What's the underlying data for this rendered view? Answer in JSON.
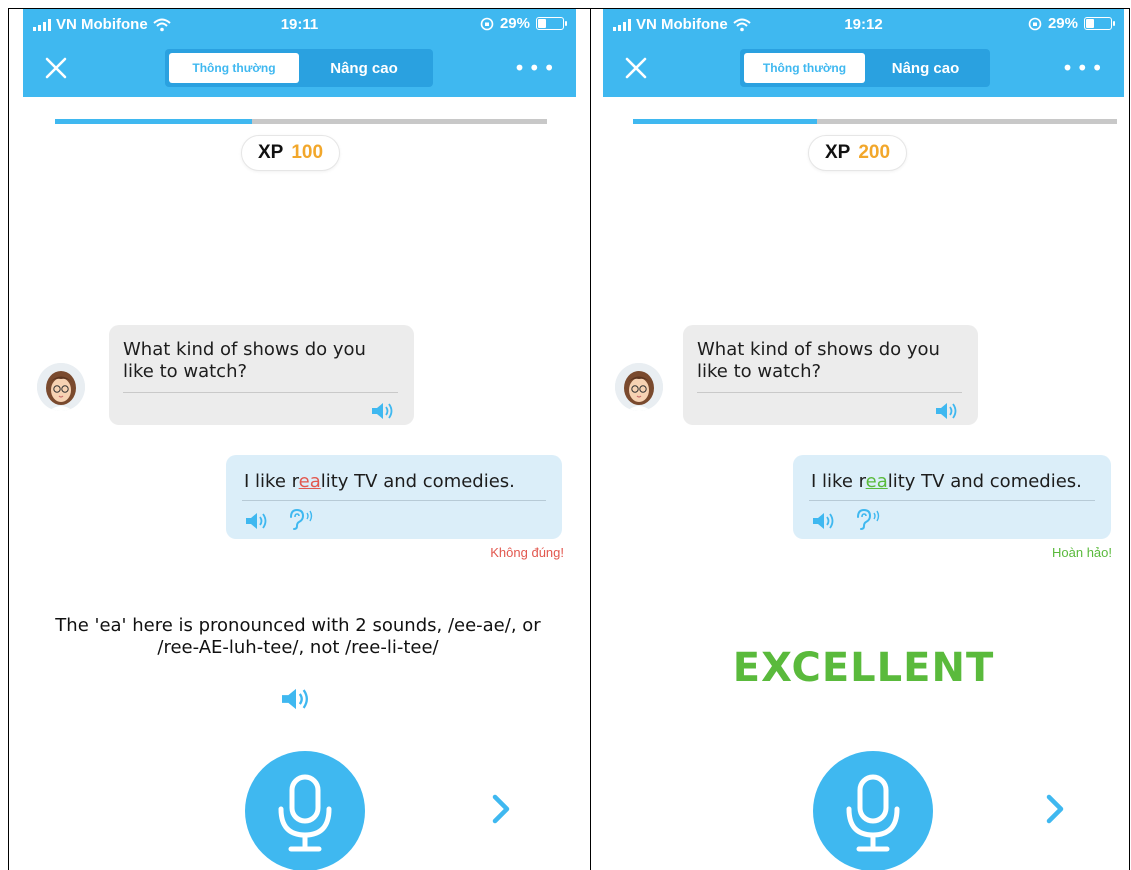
{
  "colors": {
    "brand": "#3fb8f0",
    "xp_value": "#f2a72b",
    "incorrect": "#e2584f",
    "correct": "#5aba3c"
  },
  "screens": [
    {
      "status": {
        "carrier": "VN Mobifone",
        "time": "19:11",
        "battery": "29%"
      },
      "tabs": {
        "normal": "Thông thường",
        "advanced": "Nâng cao",
        "active": "normal"
      },
      "progress": 0.4,
      "xp": {
        "label": "XP",
        "value": "100"
      },
      "question": {
        "text": "What kind of shows do you like to watch?"
      },
      "answer": {
        "before": "I like r",
        "highlight": "ea",
        "after": "lity TV and comedies.",
        "highlight_color": "#e2584f"
      },
      "verdict": "Không đúng!",
      "explanation": "The 'ea' here is pronounced with 2 sounds, /ee-ae/, or /ree-AE-luh-tee/, not /ree-li-tee/",
      "icons": {
        "close": "close-icon",
        "more": "more-icon",
        "speaker": "speaker-icon",
        "ear": "ear-icon",
        "mic": "microphone-icon",
        "next": "chevron-right-icon"
      }
    },
    {
      "status": {
        "carrier": "VN Mobifone",
        "time": "19:12",
        "battery": "29%"
      },
      "tabs": {
        "normal": "Thông thường",
        "advanced": "Nâng cao",
        "active": "normal"
      },
      "progress": 0.38,
      "xp": {
        "label": "XP",
        "value": "200"
      },
      "question": {
        "text": "What kind of shows do you like to watch?"
      },
      "answer": {
        "before": "I like r",
        "highlight": "ea",
        "after": "lity TV and comedies.",
        "highlight_color": "#5aba3c"
      },
      "verdict": "Hoàn hảo!",
      "feedback": "EXCELLENT",
      "icons": {
        "close": "close-icon",
        "more": "more-icon",
        "speaker": "speaker-icon",
        "ear": "ear-icon",
        "mic": "microphone-icon",
        "next": "chevron-right-icon"
      }
    }
  ]
}
